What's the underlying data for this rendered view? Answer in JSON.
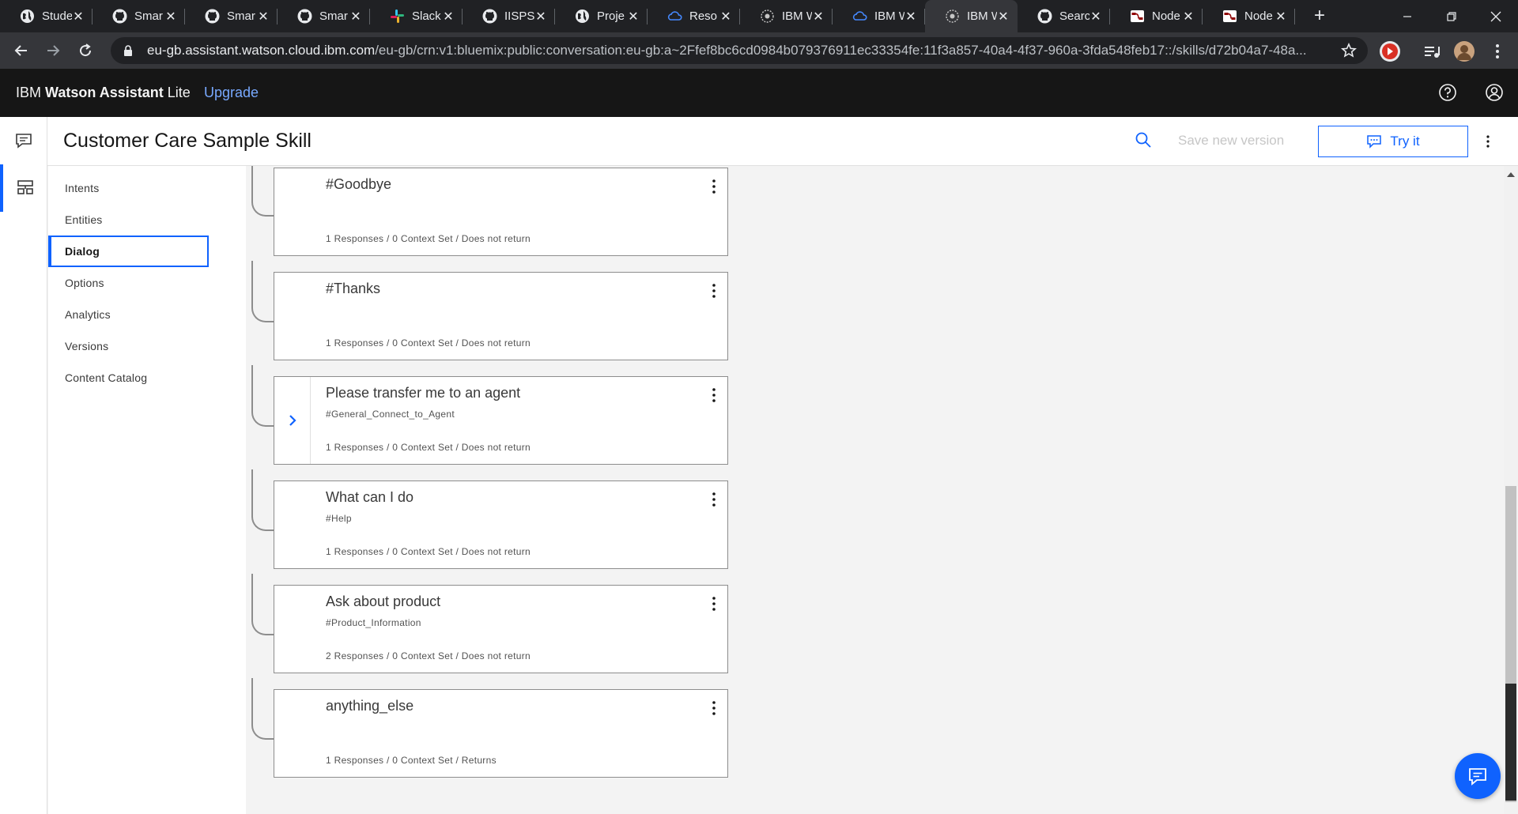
{
  "browser": {
    "tabs": [
      {
        "label": "Stude",
        "icon": "globe-icon",
        "active": false
      },
      {
        "label": "Smar",
        "icon": "github-icon",
        "active": false
      },
      {
        "label": "Smar",
        "icon": "github-icon",
        "active": false
      },
      {
        "label": "Smar",
        "icon": "github-icon",
        "active": false
      },
      {
        "label": "Slack",
        "icon": "slack-icon",
        "active": false
      },
      {
        "label": "IISPS",
        "icon": "github-icon",
        "active": false
      },
      {
        "label": "Proje",
        "icon": "globe-icon",
        "active": false
      },
      {
        "label": "Reso",
        "icon": "ibm-cloud-icon",
        "active": false
      },
      {
        "label": "IBM W",
        "icon": "ibm-bee-icon",
        "active": false
      },
      {
        "label": "IBM W",
        "icon": "ibm-cloud-icon",
        "active": false
      },
      {
        "label": "IBM W",
        "icon": "ibm-bee-icon",
        "active": true
      },
      {
        "label": "Searc",
        "icon": "github-icon",
        "active": false
      },
      {
        "label": "Node",
        "icon": "node-red-icon",
        "active": false
      },
      {
        "label": "Node",
        "icon": "node-red-icon",
        "active": false
      }
    ],
    "url_host": "eu-gb.assistant.watson.cloud.ibm.com",
    "url_path": "/eu-gb/crn:v1:bluemix:public:conversation:eu-gb:a~2Ffef8bc6cd0984b079376911ec33354fe:11f3a857-40a4-4f37-960a-3fda548feb17::/skills/d72b04a7-48a..."
  },
  "app": {
    "brand_prefix": "IBM",
    "brand_product": "Watson Assistant",
    "brand_plan": "Lite",
    "upgrade_label": "Upgrade"
  },
  "skill": {
    "title": "Customer Care Sample Skill",
    "save_version_label": "Save new version",
    "try_it_label": "Try it"
  },
  "sidenav": {
    "items": [
      {
        "label": "Intents",
        "active": false
      },
      {
        "label": "Entities",
        "active": false
      },
      {
        "label": "Dialog",
        "active": true
      },
      {
        "label": "Options",
        "active": false
      },
      {
        "label": "Analytics",
        "active": false
      },
      {
        "label": "Versions",
        "active": false
      },
      {
        "label": "Content Catalog",
        "active": false
      }
    ]
  },
  "dialog": {
    "nodes": [
      {
        "title": "#Goodbye",
        "condition": "",
        "meta": "1 Responses / 0 Context Set / Does not return",
        "has_children": false
      },
      {
        "title": "#Thanks",
        "condition": "",
        "meta": "1 Responses / 0 Context Set / Does not return",
        "has_children": false
      },
      {
        "title": "Please transfer me to an agent",
        "condition": "#General_Connect_to_Agent",
        "meta": "1 Responses / 0 Context Set / Does not return",
        "has_children": true
      },
      {
        "title": "What can I do",
        "condition": "#Help",
        "meta": "1 Responses / 0 Context Set / Does not return",
        "has_children": false
      },
      {
        "title": "Ask about product",
        "condition": "#Product_Information",
        "meta": "2 Responses / 0 Context Set / Does not return",
        "has_children": false
      },
      {
        "title": "anything_else",
        "condition": "",
        "meta": "1 Responses / 0 Context Set / Returns",
        "has_children": false
      }
    ]
  },
  "colors": {
    "accent": "#0f62fe",
    "header_bg": "#161616",
    "link": "#78a9ff"
  }
}
